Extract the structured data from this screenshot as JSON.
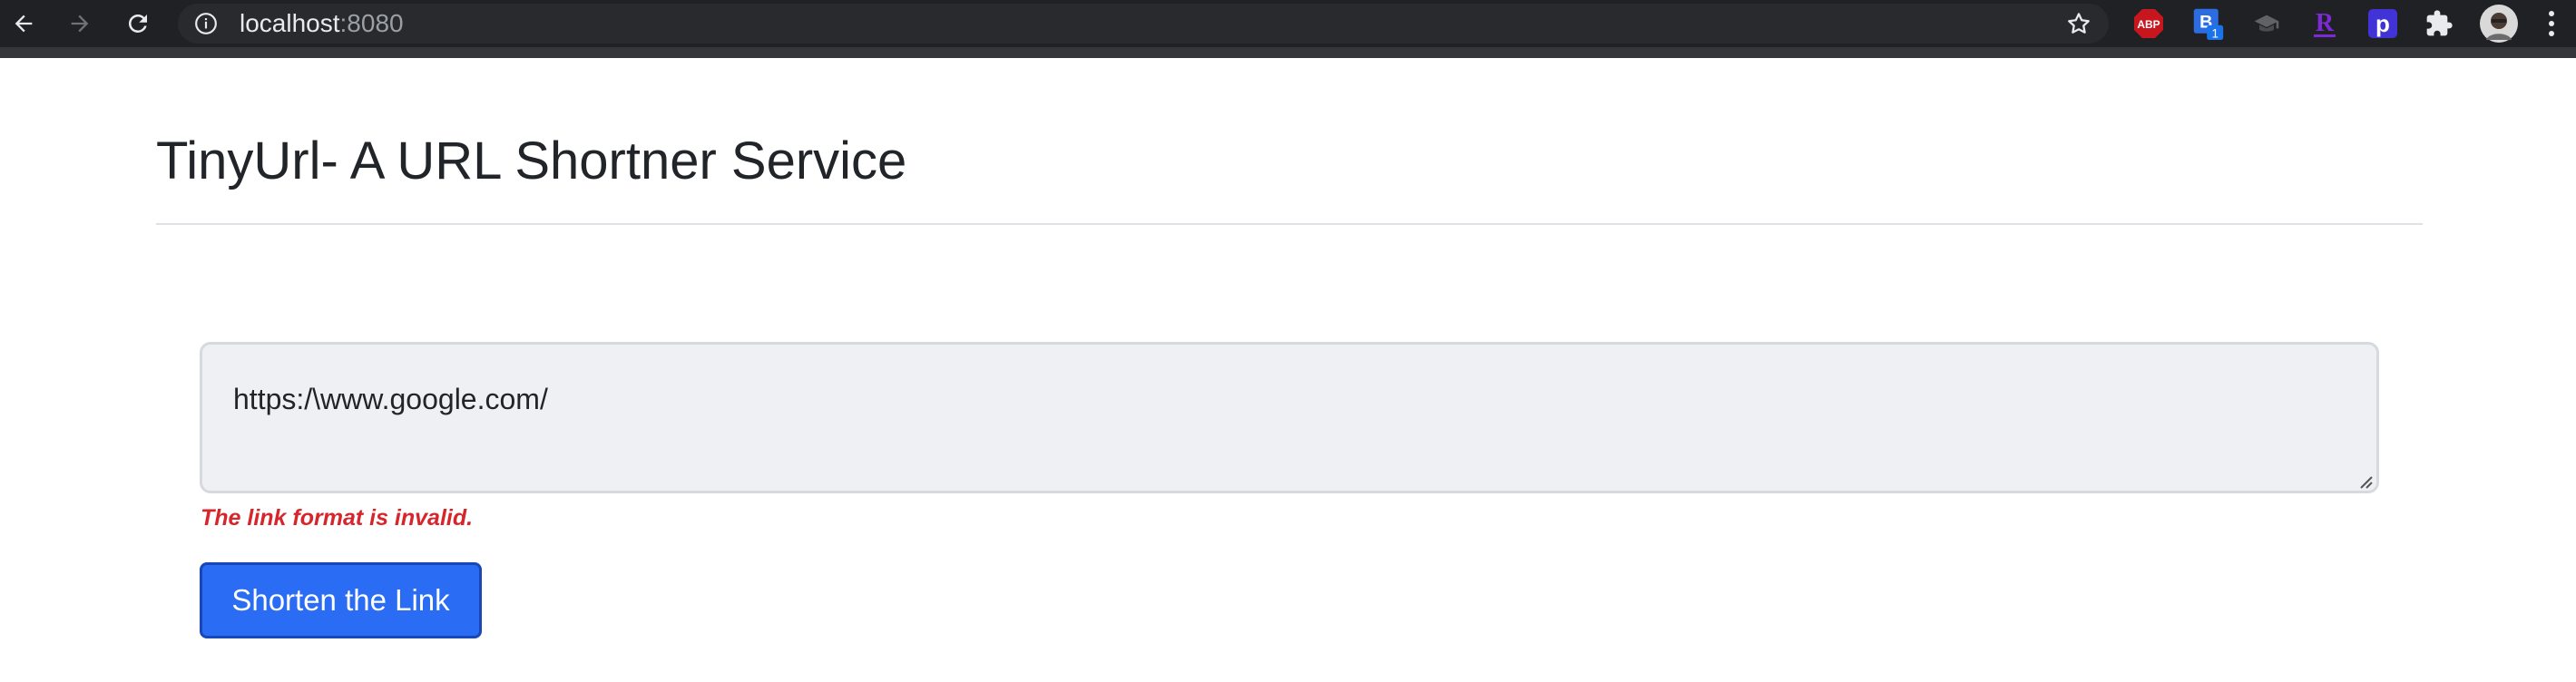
{
  "browser": {
    "url_host": "localhost",
    "url_port": ":8080",
    "extensions": [
      {
        "name": "adblock-plus-icon",
        "label": "ABP",
        "color": "#c7161e"
      },
      {
        "name": "bitwarden-icon",
        "label": "B",
        "badge": "1",
        "color": "#2b6de0"
      },
      {
        "name": "graduation-cap-icon",
        "label": "",
        "color": "#5f6368"
      },
      {
        "name": "r-extension-icon",
        "label": "R",
        "color": "#7b2ad6"
      },
      {
        "name": "p-extension-icon",
        "label": "p",
        "color": "#4233d6"
      },
      {
        "name": "puzzle-icon",
        "label": "",
        "color": "#e8eaed"
      }
    ]
  },
  "page": {
    "title": "TinyUrl- A URL Shortner Service",
    "link_input_value": "https:/\\www.google.com/",
    "error_message": "The link format is invalid.",
    "submit_label": "Shorten the Link"
  },
  "colors": {
    "chrome_bg": "#202124",
    "primary_button": "#2a6df4",
    "error_text": "#d7262b",
    "input_bg": "#eef0f4"
  }
}
